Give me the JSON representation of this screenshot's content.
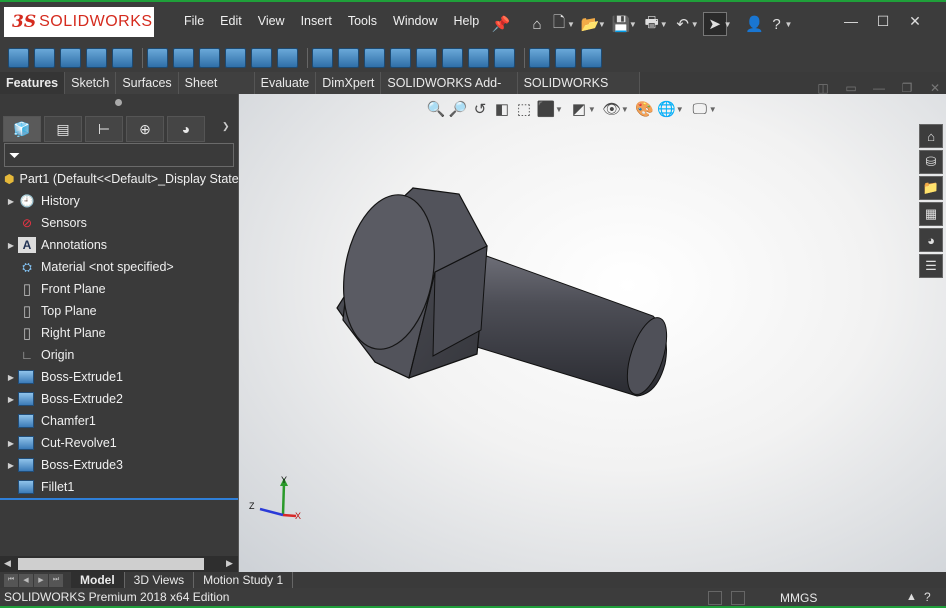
{
  "app": {
    "logo_prefix": "3S",
    "logo_name": "SOLIDWORKS",
    "accent": "#1fa03a",
    "logo_color": "#d52b1e"
  },
  "menu": [
    "File",
    "Edit",
    "View",
    "Insert",
    "Tools",
    "Window",
    "Help"
  ],
  "command_tabs": [
    {
      "label": "Features",
      "active": true
    },
    {
      "label": "Sketch"
    },
    {
      "label": "Surfaces"
    },
    {
      "label": "Sheet Metal"
    },
    {
      "label": "Evaluate"
    },
    {
      "label": "DimXpert"
    },
    {
      "label": "SOLIDWORKS Add-Ins"
    },
    {
      "label": "SOLIDWORKS MBD"
    }
  ],
  "tree": {
    "root": "Part1  (Default<<Default>_Display State",
    "nodes": [
      {
        "label": "History",
        "icon": "history-icon",
        "expandable": true
      },
      {
        "label": "Sensors",
        "icon": "sensor-icon",
        "expandable": false
      },
      {
        "label": "Annotations",
        "icon": "annotation-icon",
        "expandable": true
      },
      {
        "label": "Material <not specified>",
        "icon": "material-icon",
        "expandable": false
      },
      {
        "label": "Front Plane",
        "icon": "plane-icon",
        "expandable": false
      },
      {
        "label": "Top Plane",
        "icon": "plane-icon",
        "expandable": false
      },
      {
        "label": "Right Plane",
        "icon": "plane-icon",
        "expandable": false
      },
      {
        "label": "Origin",
        "icon": "origin-icon",
        "expandable": false
      },
      {
        "label": "Boss-Extrude1",
        "icon": "extrude-icon",
        "expandable": true
      },
      {
        "label": "Boss-Extrude2",
        "icon": "extrude-icon",
        "expandable": true
      },
      {
        "label": "Chamfer1",
        "icon": "chamfer-icon",
        "expandable": false
      },
      {
        "label": "Cut-Revolve1",
        "icon": "revolve-icon",
        "expandable": true
      },
      {
        "label": "Boss-Extrude3",
        "icon": "extrude-icon",
        "expandable": true
      },
      {
        "label": "Fillet1",
        "icon": "fillet-icon",
        "expandable": false
      }
    ]
  },
  "bottom_tabs": [
    {
      "label": "Model",
      "active": true
    },
    {
      "label": "3D Views"
    },
    {
      "label": "Motion Study 1"
    }
  ],
  "status": {
    "edition": "SOLIDWORKS Premium 2018 x64 Edition",
    "units": "MMGS"
  },
  "triad": {
    "x": "X",
    "y": "Y",
    "z": "Z"
  }
}
